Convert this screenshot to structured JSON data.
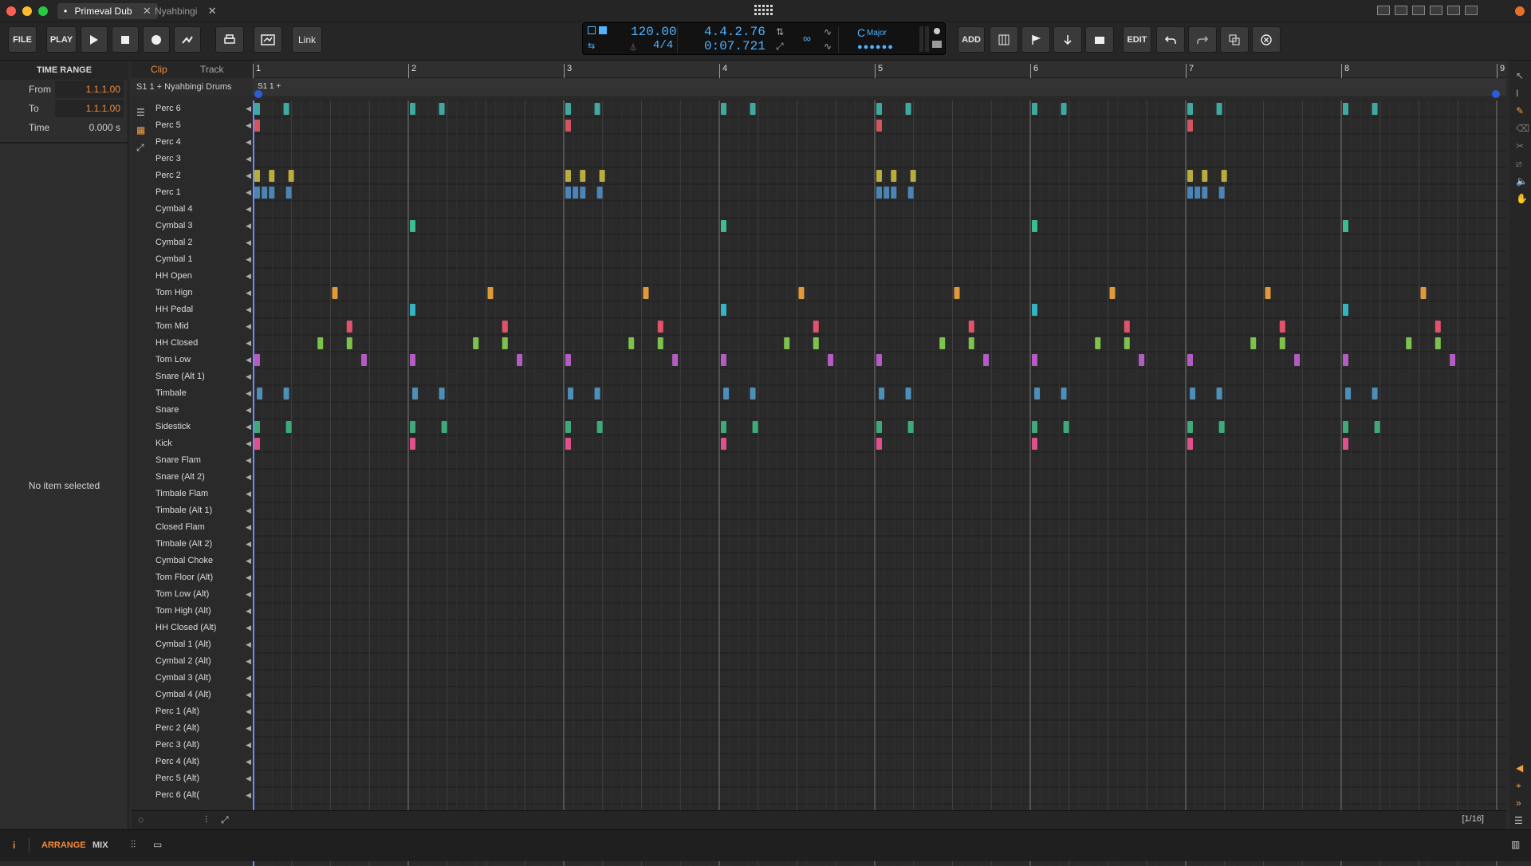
{
  "window": {
    "tabs": [
      {
        "label": "Primeval Dub",
        "modified": "•",
        "active": true
      },
      {
        "label": "Nyahbingi",
        "active": false
      }
    ]
  },
  "toolbar": {
    "file": "FILE",
    "play_label": "PLAY",
    "link": "Link",
    "add": "ADD",
    "edit": "EDIT"
  },
  "transport": {
    "tempo": "120.00",
    "time_signature": "4/4",
    "position_beats": "4.4.2.76",
    "position_time": "0:07.721",
    "key": "C",
    "scale": "Major"
  },
  "inspector": {
    "section_title": "TIME RANGE",
    "from_label": "From",
    "from_value": "1.1.1.00",
    "to_label": "To",
    "to_value": "1.1.1.00",
    "time_label": "Time",
    "time_value": "0.000 s",
    "empty_message": "No item selected"
  },
  "editor": {
    "tabs": [
      "Clip",
      "Track"
    ],
    "clip_name": "S1 1 +  Nyahbingi Drums",
    "clip_label": "S1 1 +",
    "bar_numbers": [
      "1",
      "2",
      "3",
      "4",
      "5",
      "6",
      "7",
      "8",
      "9"
    ],
    "grid_resolution": "[1/16]",
    "lanes": [
      "Perc 6",
      "Perc 5",
      "Perc 4",
      "Perc 3",
      "Perc 2",
      "Perc 1",
      "Cymbal 4",
      "Cymbal 3",
      "Cymbal 2",
      "Cymbal 1",
      "HH Open",
      "Tom Hign",
      "HH Pedal",
      "Tom Mid",
      "HH Closed",
      "Tom Low",
      "Snare  (Alt 1)",
      "Timbale",
      "Snare",
      "Sidestick",
      "Kick",
      "Snare Flam",
      "Snare (Alt 2)",
      "Timbale Flam",
      "Timbale (Alt 1)",
      "Closed Flam",
      "Timbale (Alt 2)",
      "Cymbal Choke",
      "Tom Floor (Alt)",
      "Tom Low (Alt)",
      "Tom High (Alt)",
      "HH Closed (Alt)",
      "Cymbal 1 (Alt)",
      "Cymbal 2 (Alt)",
      "Cymbal 3 (Alt)",
      "Cymbal 4 (Alt)",
      "Perc 1 (Alt)",
      "Perc 2 (Alt)",
      "Perc 3 (Alt)",
      "Perc 4 (Alt)",
      "Perc 5 (Alt)",
      "Perc 6 (Alt("
    ]
  },
  "note_colors": {
    "teal": "#3fa9a0",
    "red": "#d4555e",
    "yellow": "#b8ad3d",
    "blue": "#4b84b5",
    "green": "#3dbd8e",
    "orange": "#e09a3c",
    "cyan": "#33b3c4",
    "crimson": "#e2526a",
    "lime": "#7cc24d",
    "purple": "#b45cc4",
    "steel": "#4d8fb8",
    "sea": "#3eaa7a",
    "pink": "#e0508e"
  },
  "notes": [
    {
      "lane": 0,
      "color": "teal",
      "beats": [
        0,
        1,
        0.75
      ]
    },
    {
      "lane": 1,
      "color": "red",
      "beats": [
        0
      ]
    },
    {
      "lane": 4,
      "color": "yellow",
      "beats": [
        0,
        0.5,
        1.125
      ]
    },
    {
      "lane": 5,
      "color": "blue",
      "beats": [
        0,
        0.25,
        0.5,
        1.0625
      ]
    },
    {
      "lane": 7,
      "color": "green",
      "beats": []
    },
    {
      "lane": 11,
      "color": "orange",
      "beats": []
    },
    {
      "lane": 12,
      "color": "cyan",
      "beats": []
    },
    {
      "lane": 13,
      "color": "crimson",
      "beats": []
    },
    {
      "lane": 14,
      "color": "lime",
      "beats": []
    },
    {
      "lane": 15,
      "color": "purple",
      "beats": []
    },
    {
      "lane": 17,
      "color": "steel",
      "beats": [
        0.0625,
        1
      ]
    },
    {
      "lane": 19,
      "color": "sea",
      "beats": [
        0,
        1.0625
      ]
    },
    {
      "lane": 20,
      "color": "pink",
      "beats": [
        0
      ]
    }
  ],
  "status": {
    "info": "i",
    "arrange": "ARRANGE",
    "mix": "MIX"
  }
}
